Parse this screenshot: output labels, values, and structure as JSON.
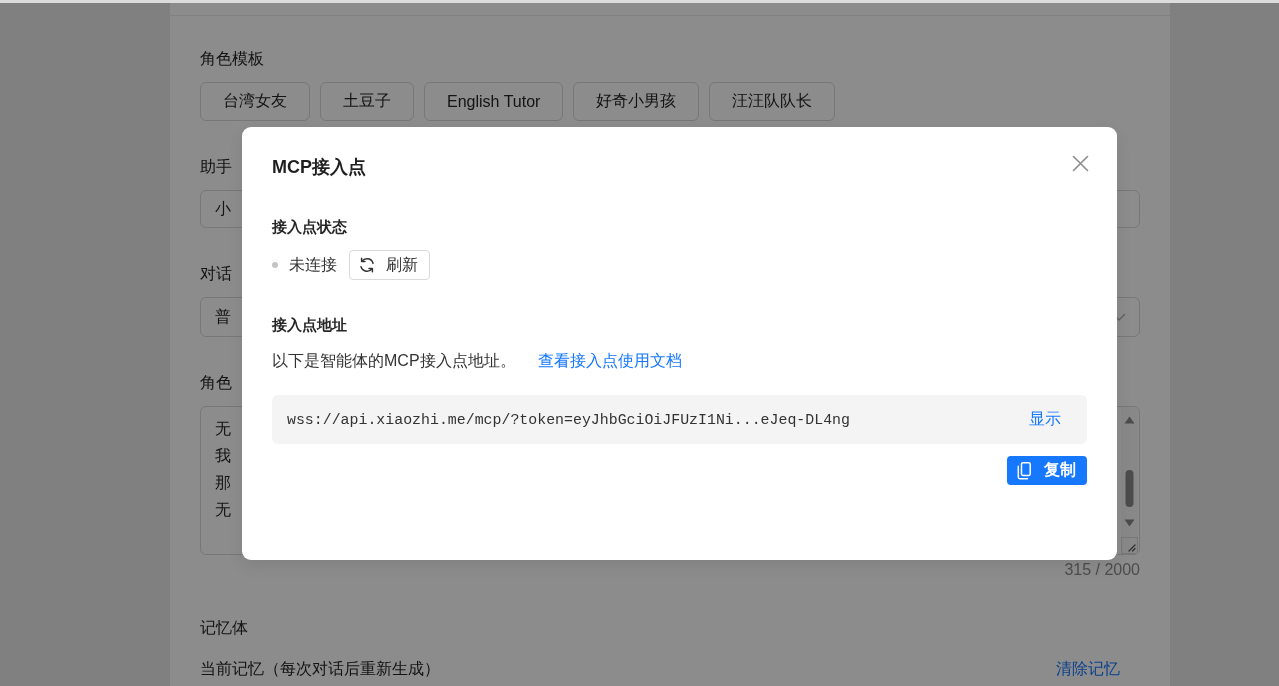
{
  "page": {
    "templates": {
      "label": "角色模板",
      "items": [
        "台湾女友",
        "土豆子",
        "English Tutor",
        "好奇小男孩",
        "汪汪队队长"
      ]
    },
    "fields": [
      {
        "kind": "input",
        "label": "助手",
        "value": "小"
      },
      {
        "kind": "select",
        "label": "对话",
        "value": "普"
      },
      {
        "kind": "textarea",
        "label": "角色",
        "lines": [
          "无",
          "我",
          "那",
          "无"
        ],
        "counter": "315 / 2000"
      }
    ],
    "memory": {
      "label": "记忆体",
      "current_label": "当前记忆（每次对话后重新生成）",
      "clear_link": "清除记忆"
    }
  },
  "modal": {
    "title": "MCP接入点",
    "status_section": {
      "heading": "接入点状态",
      "status": {
        "text": "未连接",
        "connected": false
      },
      "refresh_button": "刷新"
    },
    "address_section": {
      "heading": "接入点地址",
      "description": "以下是智能体的MCP接入点地址。",
      "docs_link": "查看接入点使用文档",
      "address": "wss://api.xiaozhi.me/mcp/?token=eyJhbGciOiJFUzI1Ni...eJeq-DL4ng",
      "show_link": "显示",
      "copy_button": "复制"
    }
  }
}
